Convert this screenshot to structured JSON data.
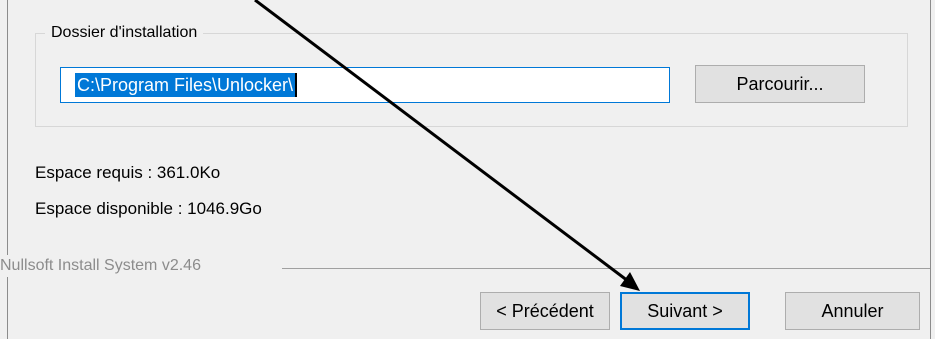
{
  "group": {
    "label": "Dossier d'installation"
  },
  "path_input": {
    "value": "C:\\Program Files\\Unlocker\\"
  },
  "buttons": {
    "browse": "Parcourir...",
    "previous": "< Précédent",
    "next": "Suivant >",
    "cancel": "Annuler"
  },
  "info": {
    "required": "Espace requis : 361.0Ko",
    "available": "Espace disponible : 1046.9Go"
  },
  "footer": {
    "brand": "Nullsoft Install System v2.46"
  },
  "annotation": {
    "arrow_color": "#000000",
    "arrow_target": "next-button"
  },
  "colors": {
    "accent": "#0078d7",
    "window_bg": "#f0f0f0",
    "button_bg": "#e1e1e1"
  }
}
